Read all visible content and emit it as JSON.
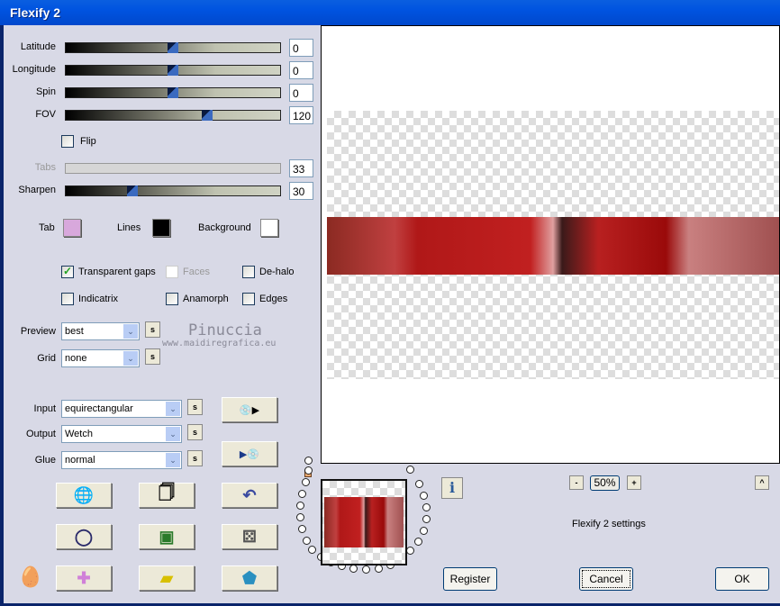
{
  "window": {
    "title": "Flexify 2"
  },
  "sliders": [
    {
      "label": "Latitude",
      "value": "0",
      "fraction": 0.5,
      "disabled": false
    },
    {
      "label": "Longitude",
      "value": "0",
      "fraction": 0.5,
      "disabled": false
    },
    {
      "label": "Spin",
      "value": "0",
      "fraction": 0.5,
      "disabled": false
    },
    {
      "label": "FOV",
      "value": "120",
      "fraction": 0.66,
      "disabled": false
    },
    {
      "label": "Tabs",
      "value": "33",
      "fraction": null,
      "disabled": true
    },
    {
      "label": "Sharpen",
      "value": "30",
      "fraction": 0.31,
      "disabled": false
    }
  ],
  "flip": {
    "label": "Flip",
    "checked": false
  },
  "colors": [
    {
      "label": "Tab",
      "color": "#d8a8dc"
    },
    {
      "label": "Lines",
      "color": "#000000"
    },
    {
      "label": "Background",
      "color": "#ffffff"
    }
  ],
  "options": [
    {
      "label": "Transparent gaps",
      "checked": true,
      "disabled": false
    },
    {
      "label": "Faces",
      "checked": false,
      "disabled": true
    },
    {
      "label": "De-halo",
      "checked": false,
      "disabled": false
    },
    {
      "label": "Indicatrix",
      "checked": false,
      "disabled": false
    },
    {
      "label": "Anamorph",
      "checked": false,
      "disabled": false
    },
    {
      "label": "Edges",
      "checked": false,
      "disabled": false
    }
  ],
  "selects": [
    {
      "label": "Preview",
      "value": "best"
    },
    {
      "label": "Grid",
      "value": "none"
    },
    {
      "label": "Input",
      "value": "equirectangular"
    },
    {
      "label": "Output",
      "value": "Wetch"
    },
    {
      "label": "Glue",
      "value": "normal"
    }
  ],
  "s_label": "s",
  "watermark": {
    "name": "Pinuccia",
    "url": "www.maidiregrafica.eu"
  },
  "toolbar_icons": [
    "load-preset-icon",
    "save-preset-icon",
    "random-icon",
    "new-icon",
    "undo-icon",
    "torus-icon",
    "square-icon",
    "dice-icon",
    "cross-icon",
    "brick-icon",
    "pentagon-icon"
  ],
  "zoom": {
    "minus": "-",
    "value": "50%",
    "plus": "+"
  },
  "collapse_label": "^",
  "info_label": "i",
  "settings_title": "Flexify 2 settings",
  "buttons": {
    "register": "Register",
    "cancel": "Cancel",
    "ok": "OK"
  }
}
